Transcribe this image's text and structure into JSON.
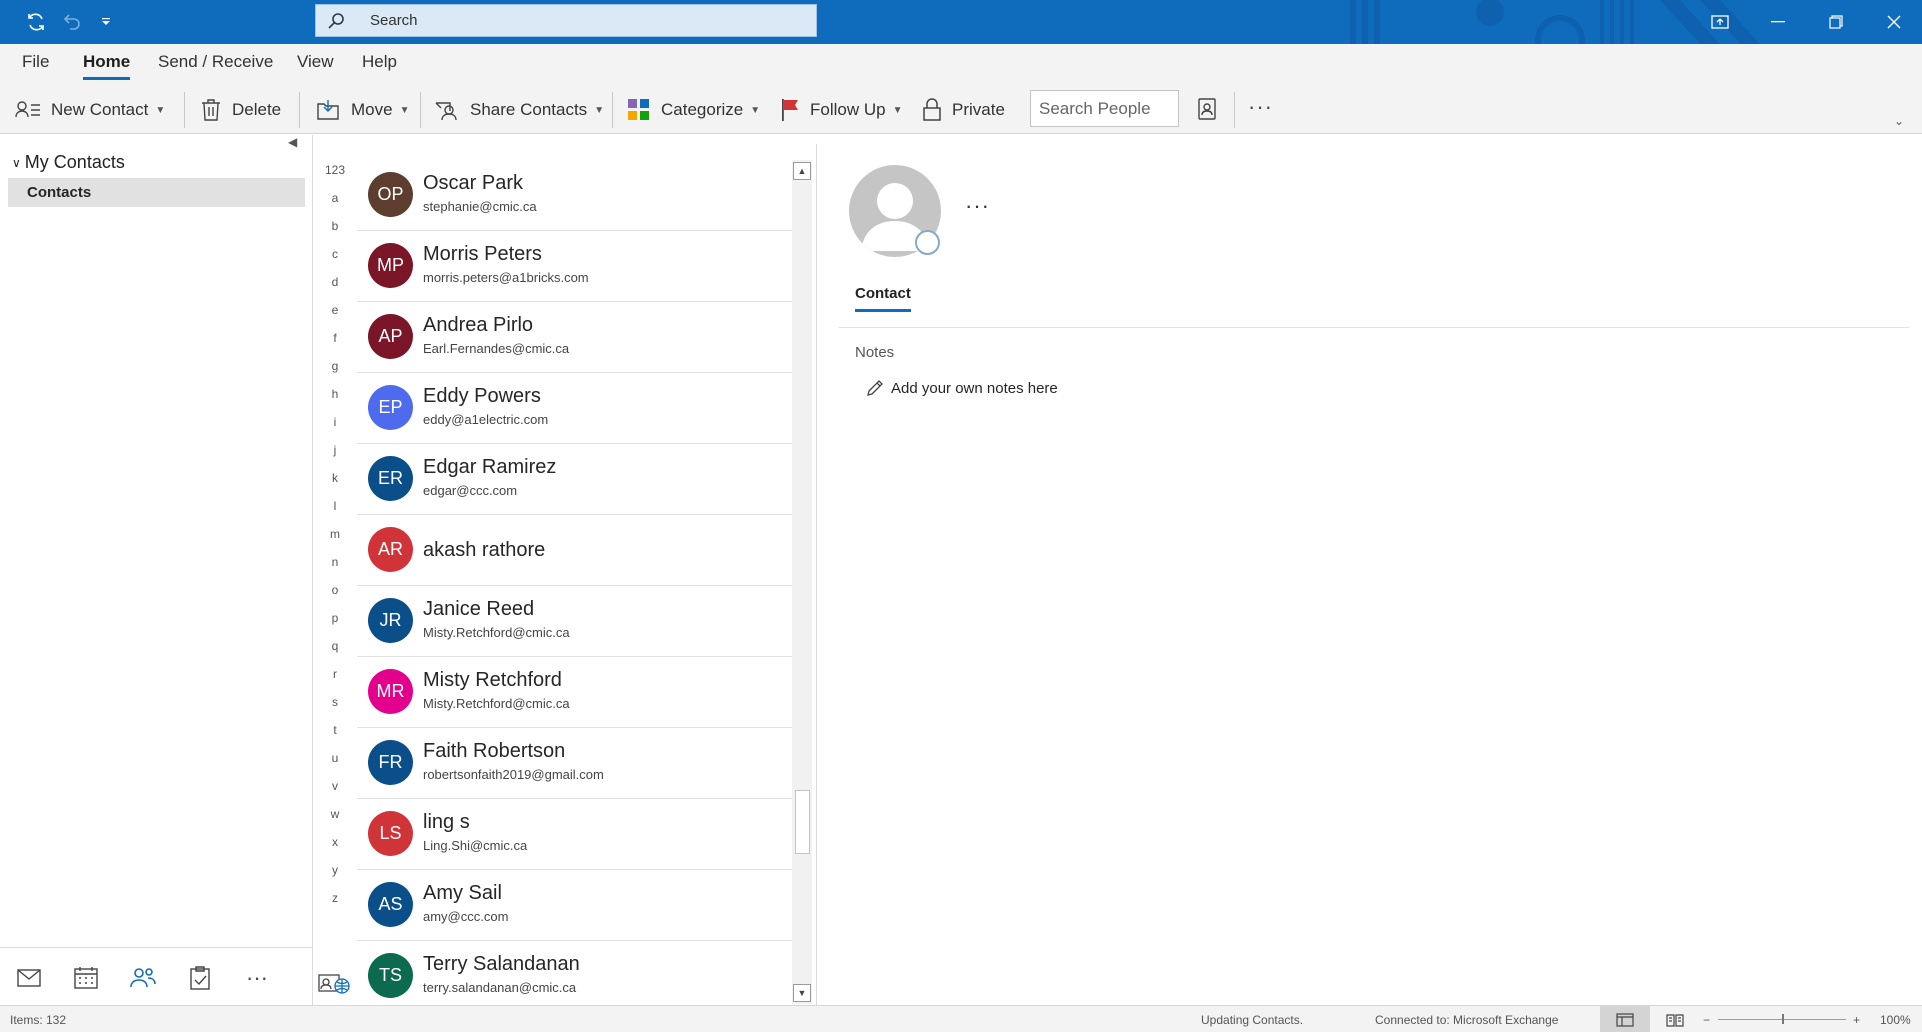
{
  "titlebar": {
    "search_placeholder": "Search",
    "icons": [
      "sync-icon",
      "undo-icon",
      "customize-quick-access-icon",
      "restore-ribbon-icon",
      "minimize-icon",
      "maximize-icon",
      "close-icon"
    ]
  },
  "tabs": [
    {
      "label": "File",
      "active": false
    },
    {
      "label": "Home",
      "active": true
    },
    {
      "label": "Send / Receive",
      "active": false
    },
    {
      "label": "View",
      "active": false
    },
    {
      "label": "Help",
      "active": false
    }
  ],
  "ribbon": {
    "new_contact": "New Contact",
    "delete": "Delete",
    "move": "Move",
    "share_contacts": "Share Contacts",
    "categorize": "Categorize",
    "follow_up": "Follow Up",
    "private": "Private",
    "search_people_placeholder": "Search People",
    "more": "···"
  },
  "left_pane": {
    "group_label": "My Contacts",
    "folder_label": "Contacts",
    "nav_more": "···"
  },
  "alphabet": [
    "123",
    "a",
    "b",
    "c",
    "d",
    "e",
    "f",
    "g",
    "h",
    "i",
    "j",
    "k",
    "l",
    "m",
    "n",
    "o",
    "p",
    "q",
    "r",
    "s",
    "t",
    "u",
    "v",
    "w",
    "x",
    "y",
    "z"
  ],
  "contacts": [
    {
      "initials": "OP",
      "name": "Oscar Park",
      "email": "stephanie@cmic.ca",
      "color": "#5d3d2e"
    },
    {
      "initials": "MP",
      "name": "Morris Peters",
      "email": "morris.peters@a1bricks.com",
      "color": "#7a1628"
    },
    {
      "initials": "AP",
      "name": "Andrea Pirlo",
      "email": "Earl.Fernandes@cmic.ca",
      "color": "#7a1628"
    },
    {
      "initials": "EP",
      "name": "Eddy Powers",
      "email": "eddy@a1electric.com",
      "color": "#4f6bed"
    },
    {
      "initials": "ER",
      "name": "Edgar Ramirez",
      "email": "edgar@ccc.com",
      "color": "#0b4f8a"
    },
    {
      "initials": "AR",
      "name": "akash rathore",
      "email": "",
      "color": "#d13438"
    },
    {
      "initials": "JR",
      "name": "Janice Reed",
      "email": "Misty.Retchford@cmic.ca",
      "color": "#0b4f8a"
    },
    {
      "initials": "MR",
      "name": "Misty Retchford",
      "email": "Misty.Retchford@cmic.ca",
      "color": "#e3008c"
    },
    {
      "initials": "FR",
      "name": "Faith Robertson",
      "email": "robertsonfaith2019@gmail.com",
      "color": "#0b4f8a"
    },
    {
      "initials": "LS",
      "name": "ling s",
      "email": "Ling.Shi@cmic.ca",
      "color": "#d13438"
    },
    {
      "initials": "AS",
      "name": "Amy Sail",
      "email": "amy@ccc.com",
      "color": "#0b4f8a"
    },
    {
      "initials": "TS",
      "name": "Terry Salandanan",
      "email": "terry.salandanan@cmic.ca",
      "color": "#0b6a4f"
    }
  ],
  "detail": {
    "more": "···",
    "tab_contact": "Contact",
    "notes_label": "Notes",
    "notes_placeholder": "Add your own notes here"
  },
  "status": {
    "items": "Items: 132",
    "updating": "Updating Contacts.",
    "connection": "Connected to: Microsoft Exchange",
    "zoom": "100%",
    "zoom_minus": "−",
    "zoom_plus": "+"
  }
}
